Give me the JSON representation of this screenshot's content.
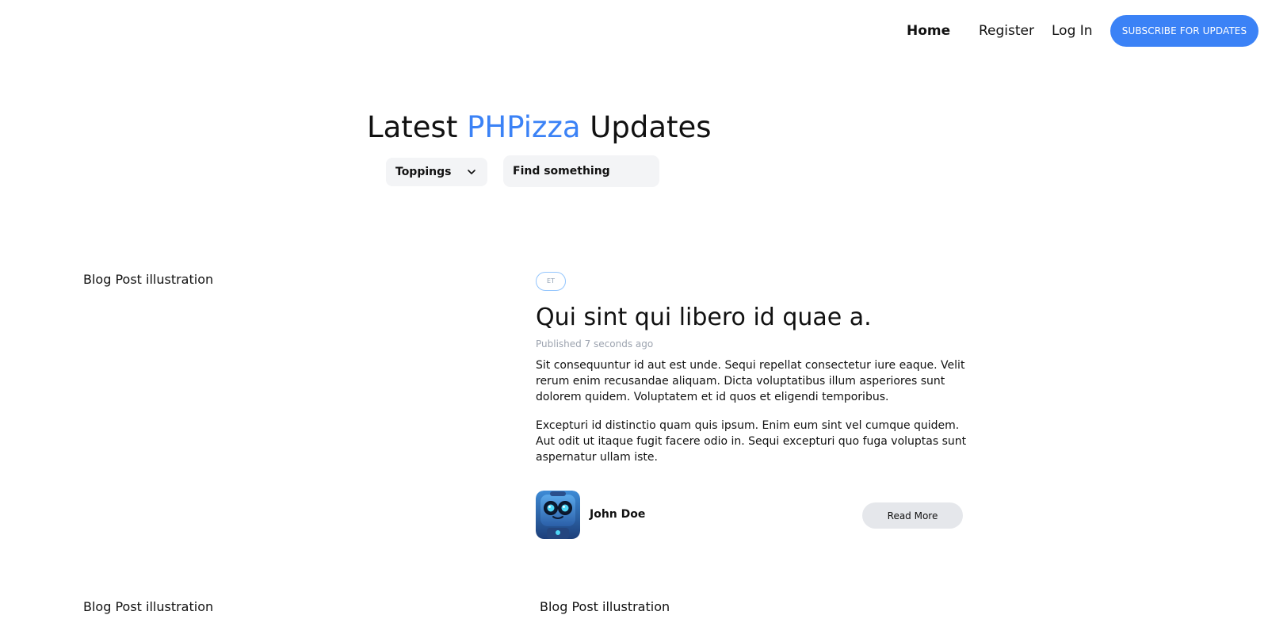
{
  "nav": {
    "home": "Home",
    "register": "Register",
    "login": "Log In",
    "subscribe": "SUBSCRIBE FOR UPDATES"
  },
  "hero": {
    "title_prefix": "Latest ",
    "title_accent": "PHPizza",
    "title_suffix": " Updates"
  },
  "filters": {
    "toppings_label": "Toppings",
    "search_placeholder": "Find something"
  },
  "posts": [
    {
      "illustration_alt": "Blog Post illustration",
      "tag": "ET",
      "title": "Qui sint qui libero id quae a.",
      "published": "Published 7 seconds ago",
      "paragraphs": [
        "Sit consequuntur id aut est unde. Sequi repellat consectetur iure eaque. Velit rerum enim recusandae aliquam. Dicta voluptatibus illum asperiores sunt dolorem quidem. Voluptatem et id quos et eligendi temporibus.",
        "Excepturi id distinctio quam quis ipsum. Enim eum sint vel cumque quidem. Aut odit ut itaque fugit facere odio in. Sequi excepturi quo fuga voluptas sunt aspernatur ullam iste."
      ],
      "author": "John Doe",
      "read_more": "Read More"
    },
    {
      "illustration_alt": "Blog Post illustration"
    },
    {
      "illustration_alt": "Blog Post illustration"
    }
  ],
  "colors": {
    "accent": "#3b82f6",
    "muted_bg": "#f3f4f6",
    "button_gray": "#e5e7eb"
  },
  "icons": {
    "toppings_dropdown": "chevron-down-icon",
    "author_avatar": "robot-avatar-icon"
  }
}
